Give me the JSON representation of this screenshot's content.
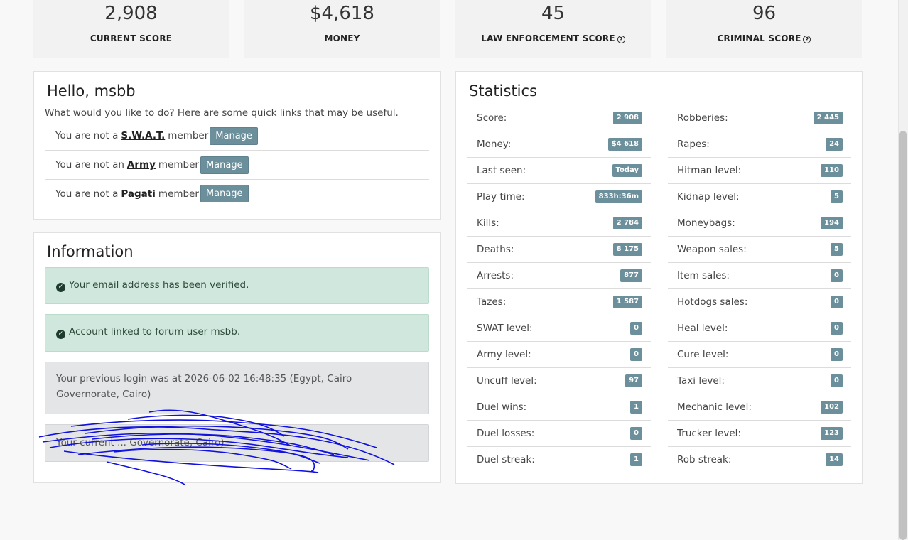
{
  "scores": [
    {
      "value": "2,908",
      "label": "CURRENT SCORE",
      "help": false
    },
    {
      "value": "$4,618",
      "label": "MONEY",
      "help": false
    },
    {
      "value": "45",
      "label": "LAW ENFORCEMENT SCORE",
      "help": true
    },
    {
      "value": "96",
      "label": "CRIMINAL SCORE",
      "help": true
    }
  ],
  "hello": {
    "title": "Hello, msbb",
    "subtitle": "What would you like to do? Here are some quick links that may be useful.",
    "memberships": [
      {
        "prefix": "You are not a",
        "org": "S.W.A.T.",
        "suffix": "member",
        "button": "Manage"
      },
      {
        "prefix": "You are not an",
        "org": "Army",
        "suffix": "member",
        "button": "Manage"
      },
      {
        "prefix": "You are not a",
        "org": "Pagati",
        "suffix": "member",
        "button": "Manage"
      }
    ]
  },
  "information": {
    "title": "Information",
    "alerts": [
      {
        "type": "success",
        "text": "Your email address has been verified."
      },
      {
        "type": "success",
        "text": "Account linked to forum user msbb."
      },
      {
        "type": "neutral",
        "text": "Your previous login was at 2026-06-02 16:48:35 (Egypt, Cairo Governorate, Cairo)"
      },
      {
        "type": "neutral",
        "text": "Your current ... Governorate, Cairo)"
      }
    ]
  },
  "statistics": {
    "title": "Statistics",
    "left": [
      {
        "label": "Score:",
        "value": "2 908"
      },
      {
        "label": "Money:",
        "value": "$4 618"
      },
      {
        "label": "Last seen:",
        "value": "Today"
      },
      {
        "label": "Play time:",
        "value": "833h:36m"
      },
      {
        "label": "Kills:",
        "value": "2 784"
      },
      {
        "label": "Deaths:",
        "value": "8 175"
      },
      {
        "label": "Arrests:",
        "value": "877"
      },
      {
        "label": "Tazes:",
        "value": "1 587"
      },
      {
        "label": "SWAT level:",
        "value": "0"
      },
      {
        "label": "Army level:",
        "value": "0"
      },
      {
        "label": "Uncuff level:",
        "value": "97"
      },
      {
        "label": "Duel wins:",
        "value": "1"
      },
      {
        "label": "Duel losses:",
        "value": "0"
      },
      {
        "label": "Duel streak:",
        "value": "1"
      }
    ],
    "right": [
      {
        "label": "Robberies:",
        "value": "2 445"
      },
      {
        "label": "Rapes:",
        "value": "24"
      },
      {
        "label": "Hitman level:",
        "value": "110"
      },
      {
        "label": "Kidnap level:",
        "value": "5"
      },
      {
        "label": "Moneybags:",
        "value": "194"
      },
      {
        "label": "Weapon sales:",
        "value": "5"
      },
      {
        "label": "Item sales:",
        "value": "0"
      },
      {
        "label": "Hotdogs sales:",
        "value": "0"
      },
      {
        "label": "Heal level:",
        "value": "0"
      },
      {
        "label": "Cure level:",
        "value": "0"
      },
      {
        "label": "Taxi level:",
        "value": "0"
      },
      {
        "label": "Mechanic level:",
        "value": "102"
      },
      {
        "label": "Trucker level:",
        "value": "123"
      },
      {
        "label": "Rob streak:",
        "value": "14"
      }
    ]
  }
}
